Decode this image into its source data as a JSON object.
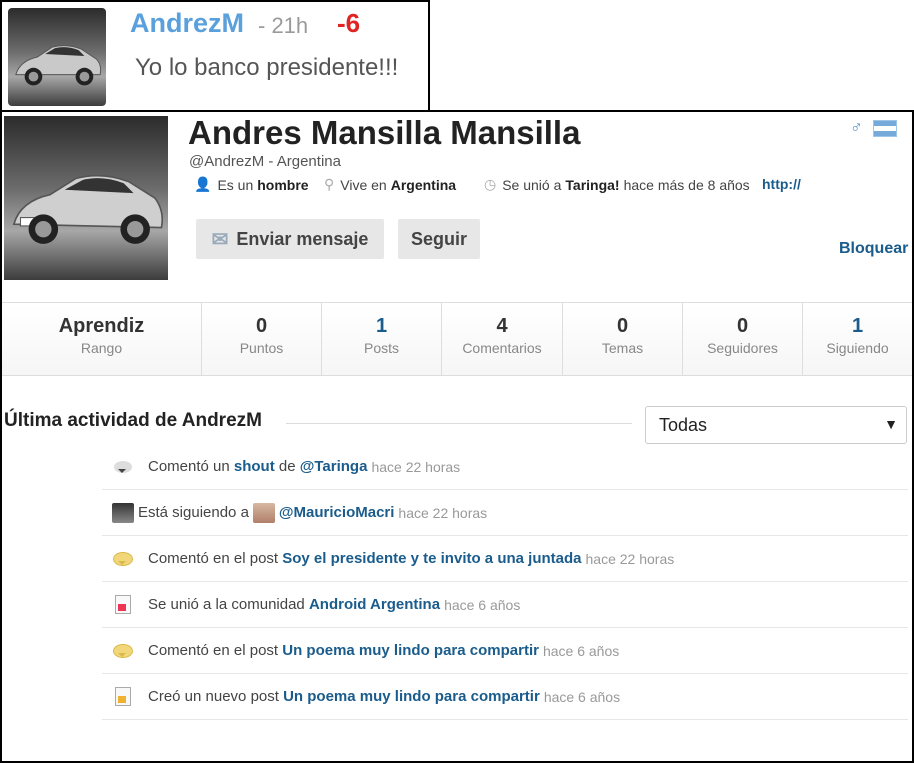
{
  "comment": {
    "user": "AndrezM",
    "time": "- 21h",
    "score": "-6",
    "text": "Yo lo banco presidente!!!"
  },
  "profile": {
    "name": "Andres Mansilla Mansilla",
    "handle": "@AndrezM - Argentina",
    "gender_prefix": "Es un",
    "gender": "hombre",
    "location_prefix": "Vive en",
    "location": "Argentina",
    "joined_prefix": "Se unió a",
    "joined_site": "Taringa!",
    "joined_suffix": "hace más de 8 años",
    "website": "http://",
    "send_message_label": "Enviar mensaje",
    "follow_label": "Seguir",
    "block_label": "Bloquear",
    "stats": [
      {
        "value": "Aprendiz",
        "label": "Rango"
      },
      {
        "value": "0",
        "label": "Puntos"
      },
      {
        "value": "1",
        "label": "Posts"
      },
      {
        "value": "4",
        "label": "Comentarios"
      },
      {
        "value": "0",
        "label": "Temas"
      },
      {
        "value": "0",
        "label": "Seguidores"
      },
      {
        "value": "1",
        "label": "Siguiendo"
      }
    ]
  },
  "activity": {
    "title": "Última actividad de AndrezM",
    "filter": "Todas",
    "items": [
      {
        "pre": "Comentó un",
        "link": "shout",
        "mid": "de",
        "link2": "@Taringa",
        "time": "hace 22 horas"
      },
      {
        "pre": "Está siguiendo a",
        "link": "@MauricioMacri",
        "time": "hace 22 horas"
      },
      {
        "pre": "Comentó en el post",
        "link": "Soy el presidente y te invito a una juntada",
        "time": "hace 22 horas"
      },
      {
        "pre": "Se unió a la comunidad",
        "link": "Android Argentina",
        "time": "hace 6 años"
      },
      {
        "pre": "Comentó en el post",
        "link": "Un poema muy lindo para compartir",
        "time": "hace 6 años"
      },
      {
        "pre": "Creó un nuevo post",
        "link": "Un poema muy lindo para compartir",
        "time": "hace 6 años"
      }
    ]
  }
}
